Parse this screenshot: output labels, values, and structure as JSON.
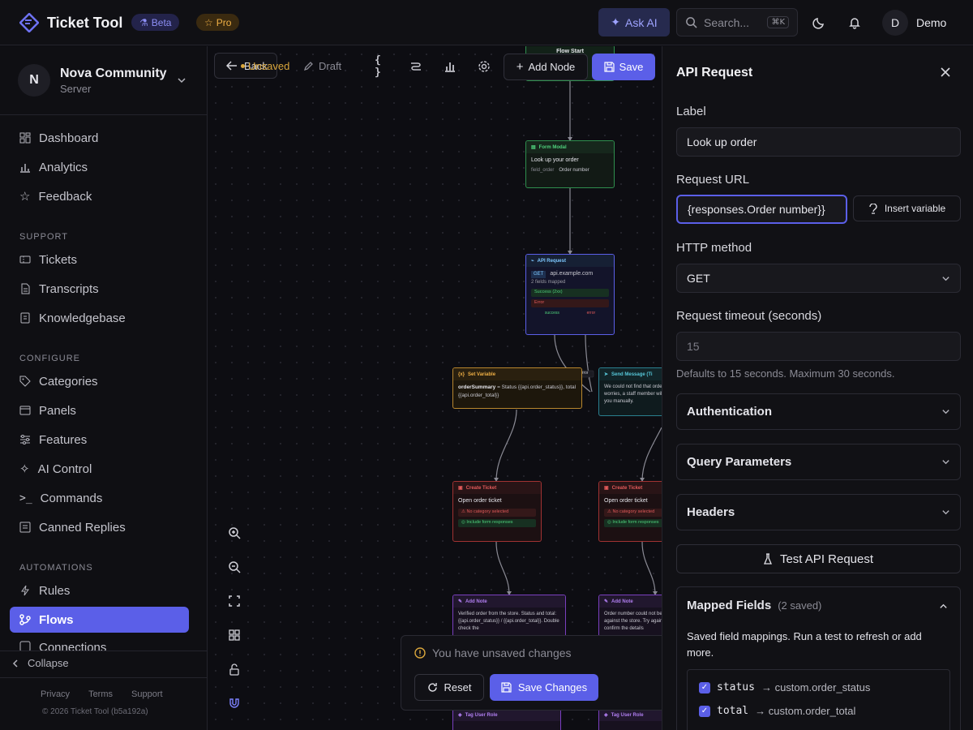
{
  "header": {
    "brand": "Ticket Tool",
    "beta_badge": "Beta",
    "pro_badge": "Pro",
    "ask_ai": "Ask AI",
    "search_placeholder": "Search...",
    "search_shortcut": "⌘K",
    "user_initial": "D",
    "user_name": "Demo"
  },
  "server": {
    "initial": "N",
    "name": "Nova Community",
    "type": "Server"
  },
  "sidebar": {
    "main": [
      {
        "label": "Dashboard",
        "icon": "dashboard-icon"
      },
      {
        "label": "Analytics",
        "icon": "analytics-icon"
      },
      {
        "label": "Feedback",
        "icon": "star-icon"
      }
    ],
    "support_title": "SUPPORT",
    "support": [
      {
        "label": "Tickets",
        "icon": "ticket-icon"
      },
      {
        "label": "Transcripts",
        "icon": "transcript-icon"
      },
      {
        "label": "Knowledgebase",
        "icon": "book-icon"
      }
    ],
    "configure_title": "CONFIGURE",
    "configure": [
      {
        "label": "Categories",
        "icon": "tag-icon"
      },
      {
        "label": "Panels",
        "icon": "panel-icon"
      },
      {
        "label": "Features",
        "icon": "features-icon"
      },
      {
        "label": "AI Control",
        "icon": "sparkle-icon"
      },
      {
        "label": "Commands",
        "icon": "terminal-icon"
      },
      {
        "label": "Canned Replies",
        "icon": "replies-icon"
      }
    ],
    "automations_title": "AUTOMATIONS",
    "automations": [
      {
        "label": "Rules",
        "icon": "bolt-icon"
      },
      {
        "label": "Flows",
        "icon": "flow-icon",
        "active": true
      },
      {
        "label": "Connections",
        "icon": "connection-icon"
      }
    ],
    "collapse": "Collapse",
    "footer_links": [
      "Privacy",
      "Terms",
      "Support"
    ],
    "copyright": "© 2026 Ticket Tool (b5a192a)"
  },
  "canvas_toolbar": {
    "back": "Back",
    "unsaved": "Unsaved",
    "draft": "Draft",
    "add_node": "Add Node",
    "save": "Save"
  },
  "nodes": {
    "flow_start": {
      "title": "Flow Start"
    },
    "form_modal": {
      "title": "Form Modal",
      "text": "Look up your order",
      "field_key": "field_order",
      "field_label": "Order number"
    },
    "api_request": {
      "title": "API Request",
      "method": "GET",
      "host": "api.example.com",
      "mapped": "2 fields mapped",
      "success": "Success (2xx)",
      "error": "Error",
      "port_success": "success",
      "port_error": "error"
    },
    "set_variable": {
      "title": "Set Variable",
      "var": "orderSummary",
      "expr": "= Status {{api.order_status}}, total {{api.order_total}}"
    },
    "send_message": {
      "title": "Send Message (Ti",
      "text": "We could not find that order. No worries, a staff member will help you manually.",
      "edge_label": "error"
    },
    "create_ticket_1": {
      "title": "Create Ticket",
      "text": "Open order ticket",
      "warn": "No category selected",
      "include": "Include form responses"
    },
    "create_ticket_2": {
      "title": "Create Ticket",
      "text": "Open order ticket",
      "warn": "No category selected",
      "include": "Include form responses"
    },
    "add_note_1": {
      "title": "Add Note",
      "text": "Verified order from the store. Status and total: {{api.order_status}} / {{api.order_total}}. Double check the"
    },
    "add_note_2": {
      "title": "Add Note",
      "text": "Order number could not be verified against the store. Try again and confirm the details"
    },
    "tag_user_1": {
      "title": "Tag User Role"
    },
    "tag_user_2": {
      "title": "Tag User Role"
    }
  },
  "unsaved_bar": {
    "text": "You have unsaved changes",
    "reset": "Reset",
    "save_changes": "Save Changes"
  },
  "panel": {
    "title": "API Request",
    "label_label": "Label",
    "label_value": "Look up order",
    "url_label": "Request URL",
    "url_value": "{responses.Order number}}",
    "insert_variable": "Insert variable",
    "method_label": "HTTP method",
    "method_value": "GET",
    "timeout_label": "Request timeout (seconds)",
    "timeout_placeholder": "15",
    "timeout_hint": "Defaults to 15 seconds. Maximum 30 seconds.",
    "authentication": "Authentication",
    "query_params": "Query Parameters",
    "headers": "Headers",
    "test_button": "Test API Request",
    "mapped_title": "Mapped Fields",
    "mapped_count": "(2 saved)",
    "mapped_desc": "Saved field mappings. Run a test to refresh or add more.",
    "mappings": [
      {
        "key": "status",
        "target": "→ custom.order_status"
      },
      {
        "key": "total",
        "target": "→ custom.order_total"
      }
    ]
  },
  "colors": {
    "accent": "#5b5fe8",
    "warning": "#d9a63c",
    "bg": "#0d0d12"
  }
}
